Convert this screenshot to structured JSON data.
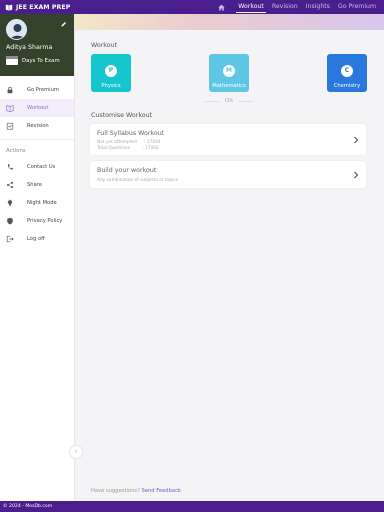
{
  "app": {
    "title": "JEE EXAM PREP"
  },
  "topnav": {
    "items": [
      {
        "label": "Workout",
        "active": true
      },
      {
        "label": "Revision",
        "active": false
      },
      {
        "label": "Insights",
        "active": false
      },
      {
        "label": "Go Premium",
        "active": false
      }
    ]
  },
  "profile": {
    "name": "Aditya Sharma",
    "days_label": "Days To Exam"
  },
  "sidebar": {
    "items": [
      {
        "label": "Go Premium",
        "icon": "lock-icon"
      },
      {
        "label": "Workout",
        "icon": "book-icon",
        "active": true
      },
      {
        "label": "Revision",
        "icon": "checklist-icon"
      }
    ],
    "actions_title": "Actions",
    "actions": [
      {
        "label": "Contact Us",
        "icon": "phone-icon"
      },
      {
        "label": "Share",
        "icon": "share-icon"
      },
      {
        "label": "Night Mode",
        "icon": "bulb-icon"
      },
      {
        "label": "Privacy Policy",
        "icon": "shield-icon"
      },
      {
        "label": "Log off",
        "icon": "logout-icon"
      }
    ]
  },
  "main": {
    "workout_title": "Workout",
    "subjects": [
      {
        "label": "Physics",
        "letter": "P",
        "color": "#16c6cf"
      },
      {
        "label": "Mathematics",
        "letter": "M",
        "color": "#5ec7e6"
      },
      {
        "label": "Chemistry",
        "letter": "C",
        "color": "#2a78de"
      }
    ],
    "or_label": "OR",
    "customise_title": "Customise Workout",
    "full_syllabus": {
      "title": "Full Syllabus Workout",
      "not_attempted_label": "Not yet attempted",
      "not_attempted_value": ": 17044",
      "total_label": "Total Questions",
      "total_value": ": 17402"
    },
    "build": {
      "title": "Build your workout",
      "subtitle": "Any combination of subjects or topics"
    },
    "suggestions_text": "Have suggestions?",
    "feedback_link": "Send Feedback"
  },
  "footer": {
    "text": "© 2024 - MosDb.com"
  },
  "colors": {
    "primary": "#4a1e8c",
    "accent": "#7a55c4"
  }
}
